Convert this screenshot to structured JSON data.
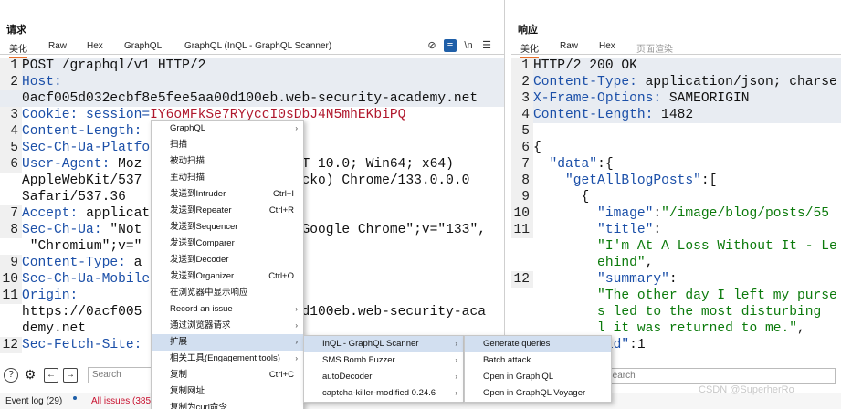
{
  "request": {
    "title": "请求",
    "tabs": [
      "美化",
      "Raw",
      "Hex",
      "GraphQL",
      "GraphQL (InQL - GraphQL Scanner)"
    ],
    "toolbar_icons": {
      "hide": "eye-slash-icon",
      "wrap": "wrap-icon",
      "newline": "\\n",
      "menu": "☰"
    },
    "lines": [
      {
        "n": "1",
        "t": [
          {
            "c": "v",
            "s": "POST /graphql/v1 HTTP/2"
          }
        ]
      },
      {
        "n": "2",
        "t": [
          {
            "c": "h",
            "s": "Host:"
          }
        ]
      },
      {
        "n": "",
        "t": [
          {
            "c": "v",
            "s": "0acf005d032ecbf8e5fee5aa00d100eb.web-security-academy.net"
          }
        ]
      },
      {
        "n": "3",
        "t": [
          {
            "c": "h",
            "s": "Cookie: session="
          },
          {
            "c": "red",
            "s": "IY6oMFkSe7RYycc"
          },
          {
            "c": "red",
            "s": "I0sDbJ4N5mhEKbiPQ"
          }
        ]
      },
      {
        "n": "4",
        "t": [
          {
            "c": "h",
            "s": "Content-Length:"
          }
        ]
      },
      {
        "n": "5",
        "t": [
          {
            "c": "h",
            "s": "Sec-Ch-Ua-Platfo"
          }
        ]
      },
      {
        "n": "6",
        "t": [
          {
            "c": "h",
            "s": "User-Agent: "
          },
          {
            "c": "v",
            "s": "Moz"
          },
          {
            "c": "v",
            "s": "                    T 10.0; Win64; x64)"
          }
        ]
      },
      {
        "n": "",
        "t": [
          {
            "c": "v",
            "s": "AppleWebKit/537"
          },
          {
            "c": "v",
            "s": "                    cko) Chrome/133.0.0.0"
          }
        ]
      },
      {
        "n": "",
        "t": [
          {
            "c": "v",
            "s": "Safari/537.36"
          }
        ]
      },
      {
        "n": "7",
        "t": [
          {
            "c": "h",
            "s": "Accept: "
          },
          {
            "c": "v",
            "s": "applicat"
          }
        ]
      },
      {
        "n": "8",
        "t": [
          {
            "c": "h",
            "s": "Sec-Ch-Ua: "
          },
          {
            "c": "v",
            "s": "\"Not"
          },
          {
            "c": "v",
            "s": "                    Google Chrome\";v=\"133\","
          }
        ]
      },
      {
        "n": "",
        "t": [
          {
            "c": "v",
            "s": " \"Chromium\";v=\""
          }
        ]
      },
      {
        "n": "9",
        "t": [
          {
            "c": "h",
            "s": "Content-Type: "
          },
          {
            "c": "v",
            "s": "a"
          }
        ]
      },
      {
        "n": "10",
        "t": [
          {
            "c": "h",
            "s": "Sec-Ch-Ua-Mobile"
          }
        ]
      },
      {
        "n": "11",
        "t": [
          {
            "c": "h",
            "s": "Origin:"
          }
        ]
      },
      {
        "n": "",
        "t": [
          {
            "c": "v",
            "s": "https://0acf005"
          },
          {
            "c": "v",
            "s": "                    d100eb.web-security-aca"
          }
        ]
      },
      {
        "n": "",
        "t": [
          {
            "c": "v",
            "s": "demy.net"
          }
        ]
      },
      {
        "n": "12",
        "t": [
          {
            "c": "h",
            "s": "Sec-Fetch-Site:"
          }
        ]
      }
    ],
    "search_placeholder": "Search"
  },
  "response": {
    "title": "响应",
    "tabs": [
      "美化",
      "Raw",
      "Hex",
      "页面渲染"
    ],
    "lines": [
      {
        "n": "1",
        "t": [
          {
            "c": "v",
            "s": "HTTP/2 200 OK"
          }
        ]
      },
      {
        "n": "2",
        "t": [
          {
            "c": "h",
            "s": "Content-Type: "
          },
          {
            "c": "v",
            "s": "application/json; charse"
          }
        ]
      },
      {
        "n": "3",
        "t": [
          {
            "c": "h",
            "s": "X-Frame-Options: "
          },
          {
            "c": "v",
            "s": "SAMEORIGIN"
          }
        ]
      },
      {
        "n": "4",
        "t": [
          {
            "c": "h",
            "s": "Content-Length: "
          },
          {
            "c": "v",
            "s": "1482"
          }
        ]
      },
      {
        "n": "5",
        "t": []
      },
      {
        "n": "6",
        "t": [
          {
            "c": "v",
            "s": "{"
          }
        ]
      },
      {
        "n": "7",
        "t": [
          {
            "c": "k",
            "s": "  \"data\""
          },
          {
            "c": "v",
            "s": ":{"
          }
        ]
      },
      {
        "n": "8",
        "t": [
          {
            "c": "k",
            "s": "    \"getAllBlogPosts\""
          },
          {
            "c": "v",
            "s": ":["
          }
        ]
      },
      {
        "n": "9",
        "t": [
          {
            "c": "v",
            "s": "      {"
          }
        ]
      },
      {
        "n": "10",
        "t": [
          {
            "c": "k",
            "s": "        \"image\""
          },
          {
            "c": "v",
            "s": ":"
          },
          {
            "c": "g",
            "s": "\"/image/blog/posts/55"
          }
        ]
      },
      {
        "n": "11",
        "t": [
          {
            "c": "k",
            "s": "        \"title\""
          },
          {
            "c": "v",
            "s": ":"
          }
        ]
      },
      {
        "n": "",
        "t": [
          {
            "c": "g",
            "s": "        \"I'm At A Loss Without It - Le"
          }
        ]
      },
      {
        "n": "",
        "t": [
          {
            "c": "g",
            "s": "        ehind\""
          },
          {
            "c": "v",
            "s": ","
          }
        ]
      },
      {
        "n": "12",
        "t": [
          {
            "c": "k",
            "s": "        \"summary\""
          },
          {
            "c": "v",
            "s": ":"
          }
        ]
      },
      {
        "n": "",
        "t": [
          {
            "c": "g",
            "s": "        \"The other day I left my purse"
          }
        ]
      },
      {
        "n": "",
        "t": [
          {
            "c": "g",
            "s": "        s led to the most disturbing"
          }
        ]
      },
      {
        "n": "",
        "t": [
          {
            "c": "g",
            "s": "        l it was returned to me.\""
          },
          {
            "c": "v",
            "s": ","
          }
        ]
      },
      {
        "n": "",
        "t": [
          {
            "c": "k",
            "s": "         id\""
          },
          {
            "c": "v",
            "s": ":1"
          }
        ]
      }
    ],
    "search_placeholder": "Search"
  },
  "context_menu": {
    "items": [
      {
        "label": "GraphQL",
        "shortcut": "",
        "arrow": true
      },
      {
        "label": "扫描",
        "shortcut": "",
        "arrow": false
      },
      {
        "label": "被动扫描",
        "shortcut": "",
        "arrow": false
      },
      {
        "label": "主动扫描",
        "shortcut": "",
        "arrow": false
      },
      {
        "label": "发送到Intruder",
        "shortcut": "Ctrl+I",
        "arrow": false
      },
      {
        "label": "发送到Repeater",
        "shortcut": "Ctrl+R",
        "arrow": false
      },
      {
        "label": "发送到Sequencer",
        "shortcut": "",
        "arrow": false
      },
      {
        "label": "发送到Comparer",
        "shortcut": "",
        "arrow": false
      },
      {
        "label": "发送到Decoder",
        "shortcut": "",
        "arrow": false
      },
      {
        "label": "发送到Organizer",
        "shortcut": "Ctrl+O",
        "arrow": false
      },
      {
        "label": "在浏览器中显示响应",
        "shortcut": "",
        "arrow": false
      },
      {
        "label": "Record an issue",
        "shortcut": "",
        "arrow": true
      },
      {
        "label": "通过浏览器请求",
        "shortcut": "",
        "arrow": true
      },
      {
        "label": "扩展",
        "shortcut": "",
        "arrow": true,
        "selected": true
      },
      {
        "label": "相关工具(Engagement tools)",
        "shortcut": "",
        "arrow": true
      },
      {
        "label": "复制",
        "shortcut": "Ctrl+C",
        "arrow": false
      },
      {
        "label": "复制网址",
        "shortcut": "",
        "arrow": false
      },
      {
        "label": "复制为curl命令",
        "shortcut": "",
        "arrow": false
      }
    ]
  },
  "extensions_menu": {
    "items": [
      {
        "label": "InQL - GraphQL Scanner",
        "arrow": true,
        "selected": true
      },
      {
        "label": "SMS Bomb Fuzzer",
        "arrow": true
      },
      {
        "label": "autoDecoder",
        "arrow": true
      },
      {
        "label": "captcha-killer-modified 0.24.6",
        "arrow": true
      }
    ]
  },
  "inql_menu": {
    "items": [
      {
        "label": "Generate queries",
        "selected": true
      },
      {
        "label": "Batch attack"
      },
      {
        "label": "Open in GraphiQL"
      },
      {
        "label": "Open in GraphQL Voyager"
      }
    ]
  },
  "status_bar": {
    "event_log": "Event log (29)",
    "all_issues": "All issues (385"
  },
  "bottom_icons": [
    "help-icon",
    "settings-icon",
    "back-icon",
    "forward-icon"
  ],
  "watermark": "CSDN @SuperherRo",
  "colors": {
    "accent": "#e8702a",
    "header_key": "#1b4fa8",
    "json_string": "#0b7a0b",
    "cookie_value": "#b0182d",
    "selection": "#d2dff0"
  }
}
